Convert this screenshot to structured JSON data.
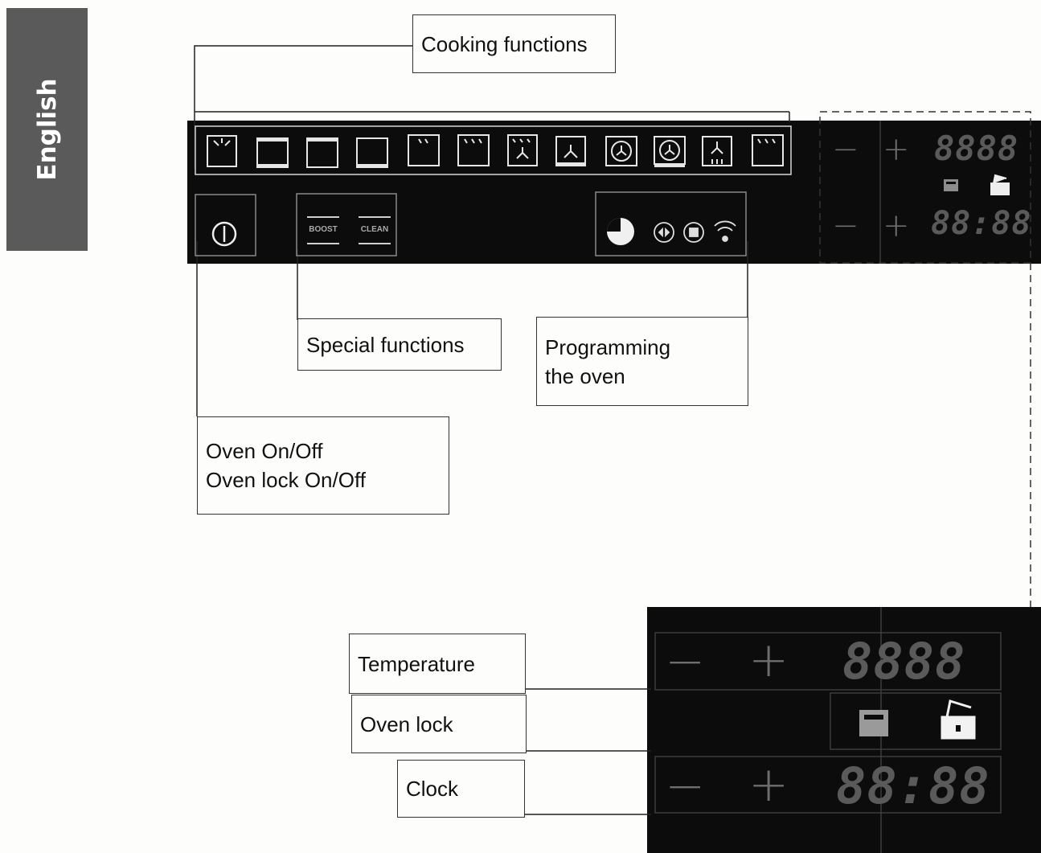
{
  "side_tab": {
    "text": "English"
  },
  "labels": {
    "cooking_functions": "Cooking functions",
    "special_functions": "Special functions",
    "programming_line1": "Programming",
    "programming_line2": "the oven",
    "onoff_line1": "Oven On/Off",
    "onoff_line2": "Oven lock On/Off",
    "temperature": "Temperature",
    "oven_lock": "Oven lock",
    "clock": "Clock"
  },
  "panel": {
    "boost": "BOOST",
    "clean": "CLEAN",
    "minus": "−",
    "plus": "+",
    "temp_display": "8888",
    "clock_display": "88:88"
  },
  "icons": {
    "cooking": [
      "grill-light-icon",
      "top-bottom-heat-icon",
      "top-heat-icon",
      "bottom-heat-icon",
      "grill-small-icon",
      "grill-large-icon",
      "fan-grill-icon",
      "fan-bottom-heat-icon",
      "fan-icon",
      "fan-ring-icon",
      "fan-top-bottom-icon",
      "grill-full-icon"
    ],
    "programming": [
      "clock-pie-icon",
      "duration-icon",
      "end-time-icon",
      "wifi-icon"
    ],
    "lock": [
      "oven-lock-icon",
      "padlock-icon"
    ]
  },
  "colors": {
    "panel": "#0c0c0c",
    "display": "#5a5a5a",
    "tab": "#5a5a5a"
  }
}
